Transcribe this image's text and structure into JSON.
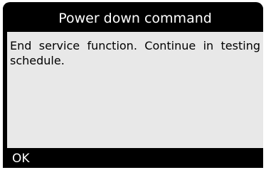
{
  "dialog": {
    "title": "Power down command",
    "message": "End service function. Continue in testing schedule.",
    "ok_label": "OK"
  },
  "colors": {
    "frame": "#000000",
    "content_bg": "#e8e8e8",
    "title_text": "#ffffff",
    "message_text": "#000000"
  }
}
